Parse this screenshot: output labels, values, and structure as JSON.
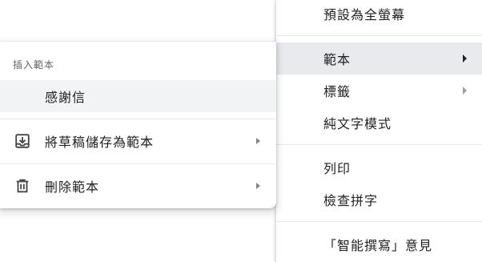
{
  "main_menu": {
    "items": [
      {
        "label": "預設為全螢幕"
      },
      {
        "label": "範本"
      },
      {
        "label": "標籤"
      },
      {
        "label": "純文字模式"
      },
      {
        "label": "列印"
      },
      {
        "label": "檢查拼字"
      },
      {
        "label": "「智能撰寫」意見"
      }
    ]
  },
  "templates_menu": {
    "header": "插入範本",
    "templates": [
      {
        "label": "感謝信"
      }
    ],
    "actions": [
      {
        "label": "將草稿儲存為範本",
        "icon": "save-draft-icon"
      },
      {
        "label": "刪除範本",
        "icon": "trash-icon"
      }
    ]
  },
  "colors": {
    "active_bg": "#e8eaed",
    "hover_bg": "#f1f3f4",
    "divider": "#e8eaed",
    "text": "#202124",
    "muted": "#5f6368"
  }
}
